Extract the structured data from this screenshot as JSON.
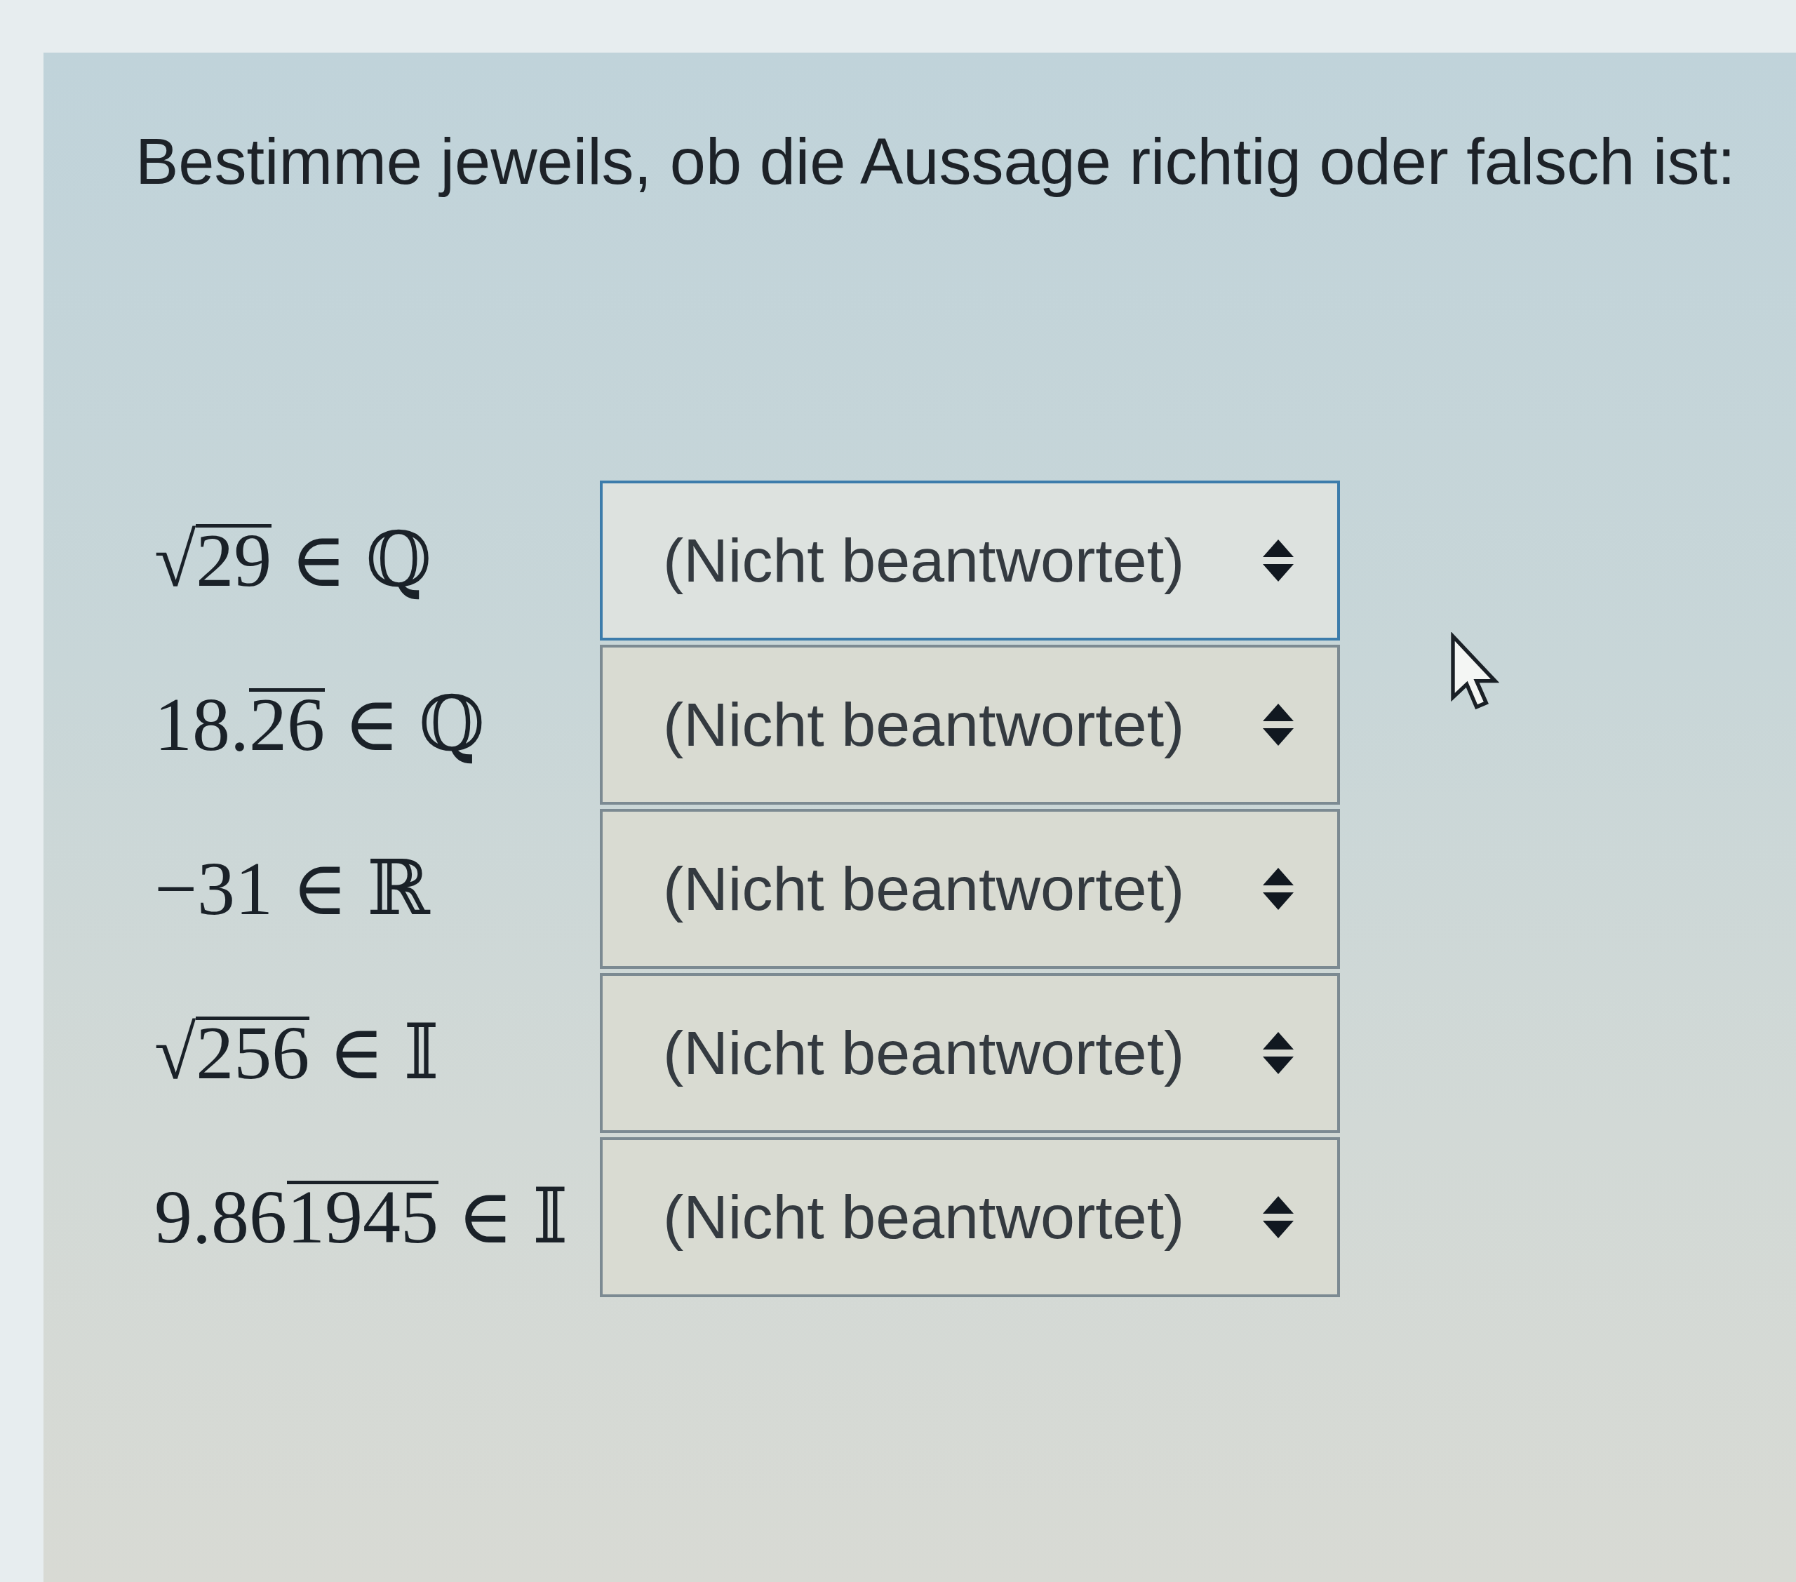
{
  "question": {
    "text": "Bestimme jeweils, ob die Aussage richtig oder falsch ist:"
  },
  "statements": [
    {
      "number": [
        {
          "kind": "plain",
          "text": "√"
        },
        {
          "kind": "overline",
          "text": "29"
        }
      ],
      "relation": "∈",
      "set": "ℚ",
      "answer": {
        "value": "(Nicht beantwortet)",
        "focused": true
      }
    },
    {
      "number": [
        {
          "kind": "plain",
          "text": "18."
        },
        {
          "kind": "overline",
          "text": "26"
        }
      ],
      "relation": "∈",
      "set": "ℚ",
      "answer": {
        "value": "(Nicht beantwortet)",
        "focused": false
      }
    },
    {
      "number": [
        {
          "kind": "plain",
          "text": "−31"
        }
      ],
      "relation": "∈",
      "set": "ℝ",
      "answer": {
        "value": "(Nicht beantwortet)",
        "focused": false
      }
    },
    {
      "number": [
        {
          "kind": "plain",
          "text": "√"
        },
        {
          "kind": "overline",
          "text": "256"
        }
      ],
      "relation": "∈",
      "set": "𝕀",
      "answer": {
        "value": "(Nicht beantwortet)",
        "focused": false
      }
    },
    {
      "number": [
        {
          "kind": "plain",
          "text": "9.86"
        },
        {
          "kind": "overline",
          "text": "1945"
        }
      ],
      "relation": "∈",
      "set": "𝕀",
      "answer": {
        "value": "(Nicht beantwortet)",
        "focused": false
      }
    }
  ]
}
